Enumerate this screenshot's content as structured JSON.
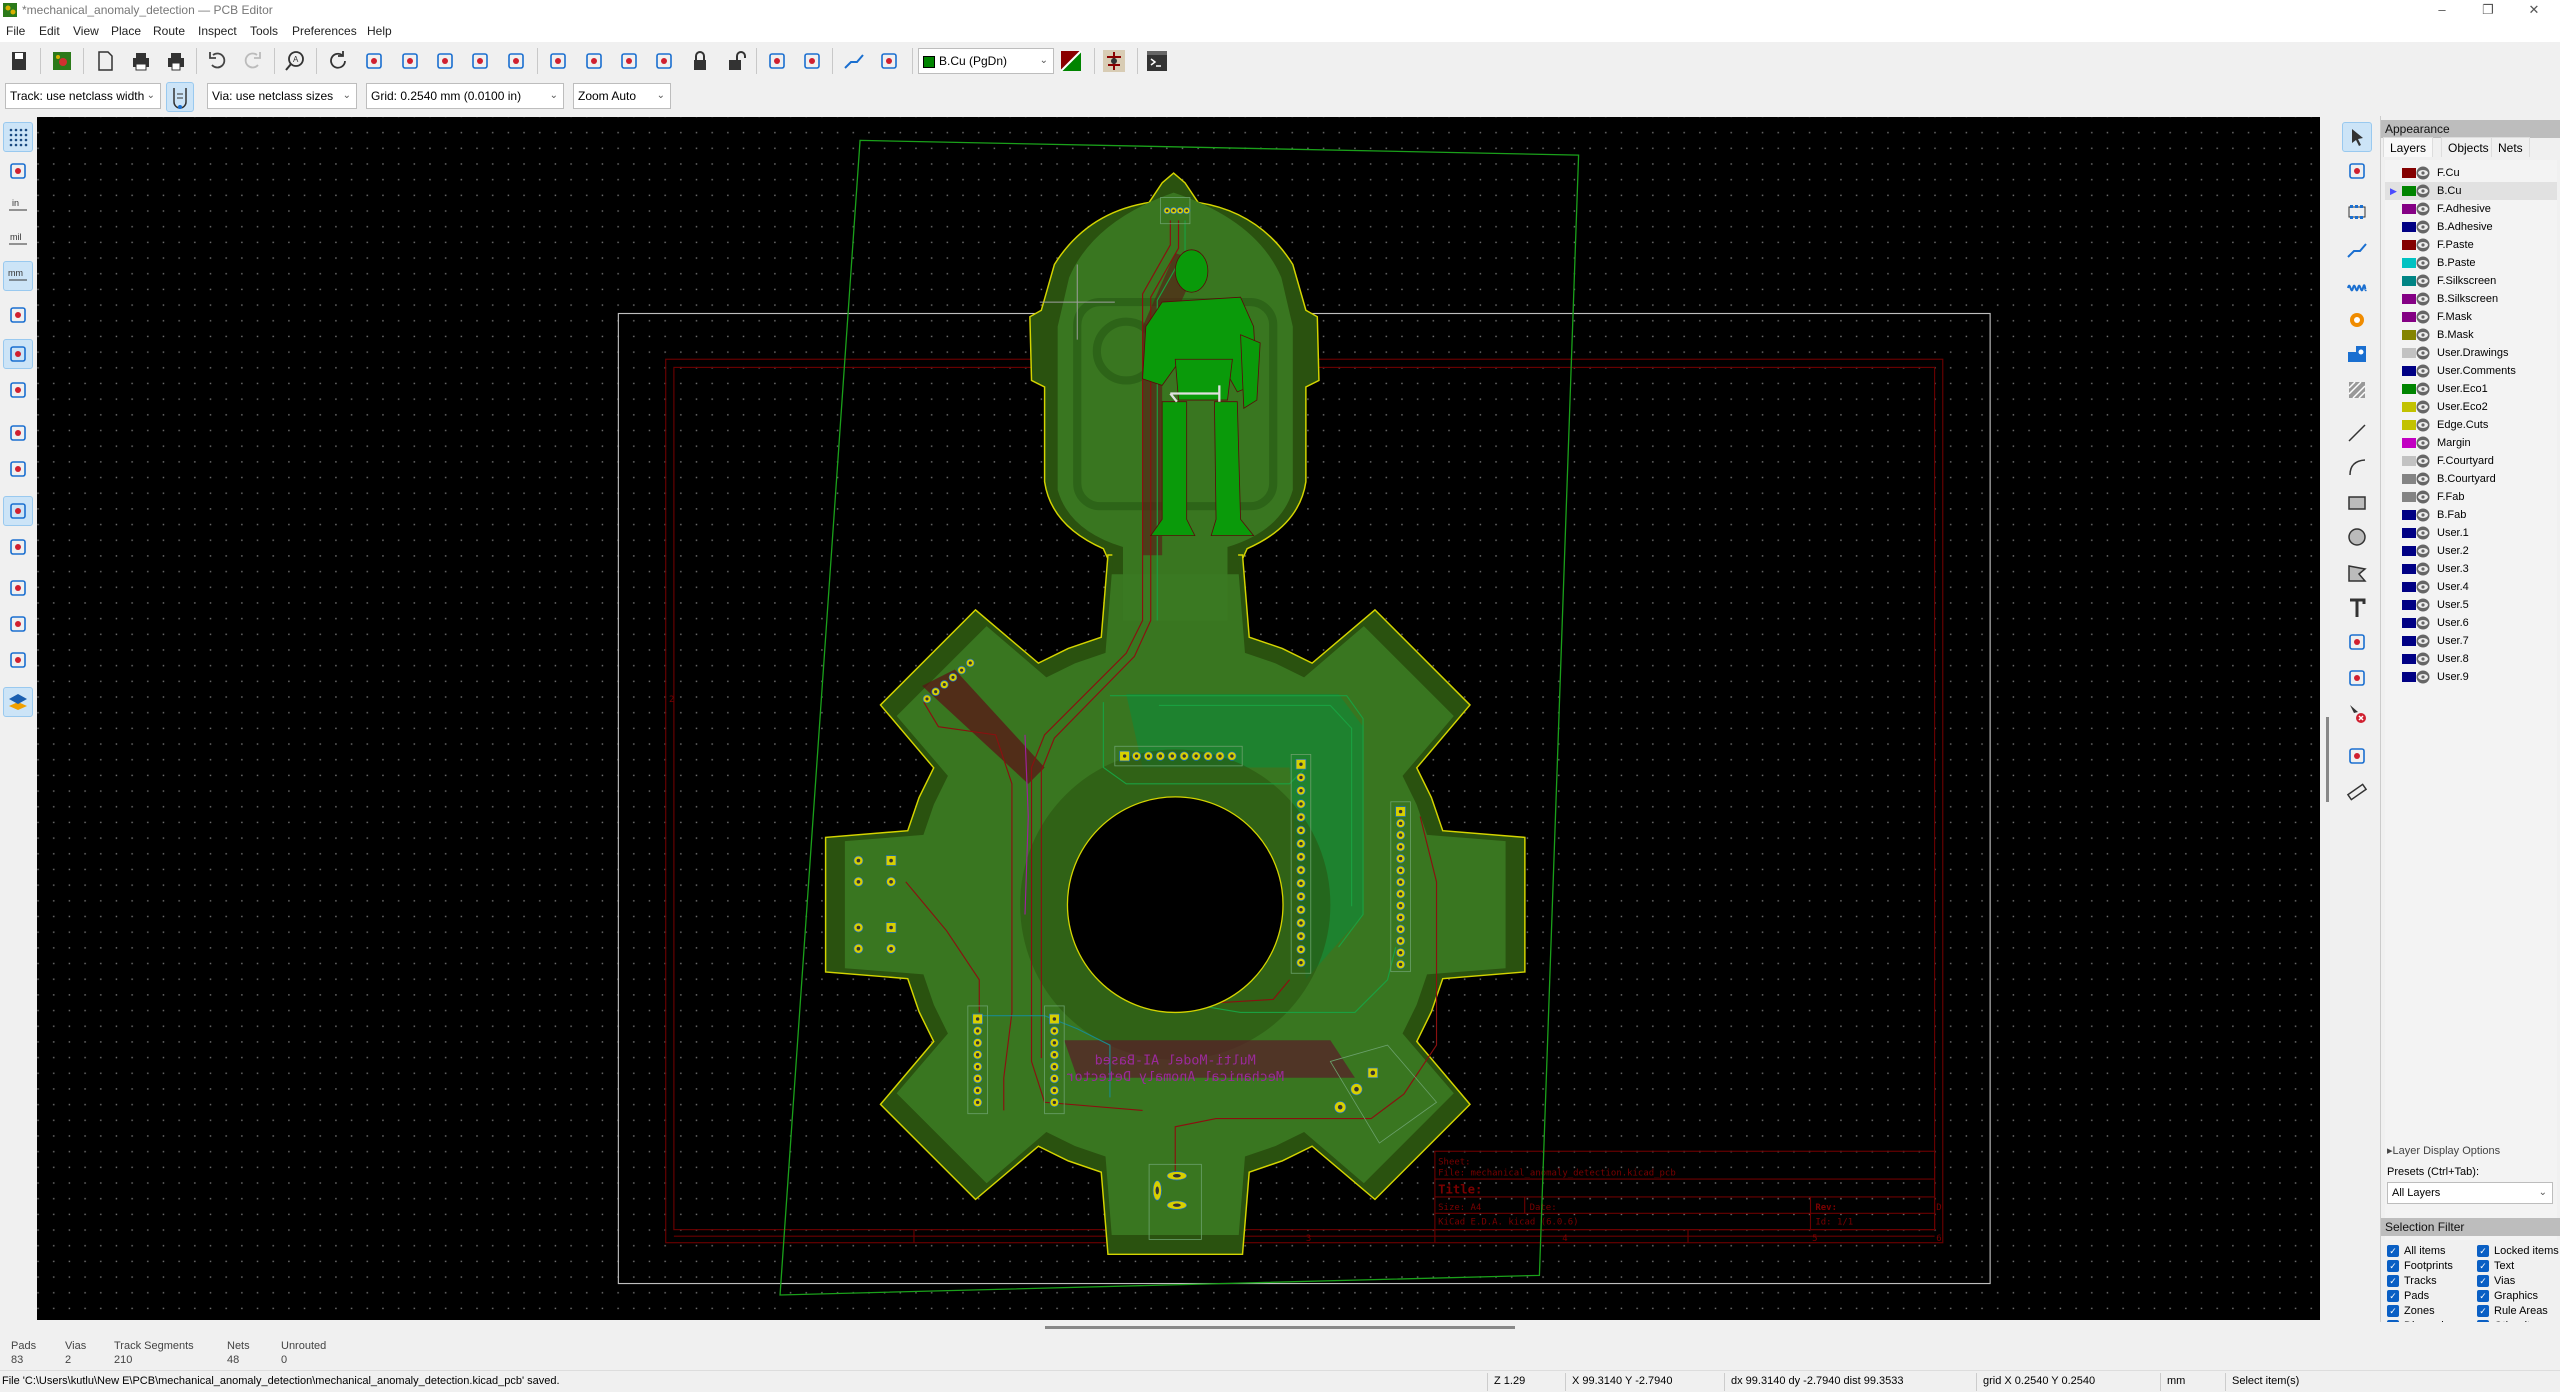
{
  "window": {
    "title": "*mechanical_anomaly_detection — PCB Editor",
    "controls": [
      "–",
      "❐",
      "✕"
    ]
  },
  "menu": [
    "File",
    "Edit",
    "View",
    "Place",
    "Route",
    "Inspect",
    "Tools",
    "Preferences",
    "Help"
  ],
  "toolbar": {
    "icons": [
      "save-icon",
      "board-setup-icon",
      "page-settings-icon",
      "print-icon",
      "plot-icon",
      "undo-icon",
      "redo-icon",
      "find-icon",
      "refresh-icon",
      "zoom-in-icon",
      "zoom-out-icon",
      "zoom-fit-icon",
      "zoom-objects-icon",
      "zoom-selection-icon",
      "rotate-ccw-icon",
      "rotate-cw-icon",
      "group-icon",
      "ungroup-icon",
      "lock-icon",
      "unlock-icon",
      "update-pcb-icon",
      "footprint-browser-icon",
      "route-track-icon",
      "drc-icon"
    ],
    "layer_select": "B.Cu (PgDn)",
    "layer_pair_icon": "layer-pair-icon",
    "extra_icons": [
      "scripting-icon",
      "terminal-icon"
    ]
  },
  "toolbar2": {
    "track": "Track: use netclass width",
    "via": "Via: use netclass sizes",
    "grid": "Grid: 0.2540 mm (0.0100 in)",
    "zoom": "Zoom Auto"
  },
  "left_toolbar": [
    "grid-dots-icon",
    "polar-coords-icon",
    "units-inch-icon",
    "units-mil-icon",
    "units-mm-icon",
    "cursor-crosshair-icon",
    "ratsnest-icon",
    "curved-ratsnest-icon",
    "high-contrast-icon",
    "track-outline-icon",
    "pad-fill-icon",
    "pad-outline-icon",
    "via-outline-icon",
    "via-fill-icon",
    "track-fill-icon",
    "layers-manager-icon"
  ],
  "left_toolbar_active": [
    0,
    4,
    6,
    10,
    15
  ],
  "right_toolbar": [
    "select-icon",
    "local-ratsnest-icon",
    "add-footprint-icon",
    "route-track-icon",
    "tune-length-icon",
    "add-via-icon",
    "add-zone-icon",
    "add-rule-area-icon",
    "draw-line-icon",
    "draw-arc-icon",
    "draw-rectangle-icon",
    "draw-circle-icon",
    "draw-polygon-icon",
    "add-text-icon",
    "add-dimension-icon",
    "add-target-icon",
    "delete-icon",
    "grid-origin-icon",
    "measure-icon"
  ],
  "appearance": {
    "title": "Appearance",
    "tabs": [
      "Layers",
      "Objects",
      "Nets"
    ],
    "active_tab": "Layers",
    "selected_layer": "B.Cu",
    "layers": [
      {
        "name": "F.Cu",
        "color": "#840000"
      },
      {
        "name": "B.Cu",
        "color": "#008400"
      },
      {
        "name": "F.Adhesive",
        "color": "#840084"
      },
      {
        "name": "B.Adhesive",
        "color": "#000084"
      },
      {
        "name": "F.Paste",
        "color": "#840000"
      },
      {
        "name": "B.Paste",
        "color": "#00c2c2"
      },
      {
        "name": "F.Silkscreen",
        "color": "#008484"
      },
      {
        "name": "B.Silkscreen",
        "color": "#840084"
      },
      {
        "name": "F.Mask",
        "color": "#840084"
      },
      {
        "name": "B.Mask",
        "color": "#848400"
      },
      {
        "name": "User.Drawings",
        "color": "#c2c2c2"
      },
      {
        "name": "User.Comments",
        "color": "#000084"
      },
      {
        "name": "User.Eco1",
        "color": "#008400"
      },
      {
        "name": "User.Eco2",
        "color": "#c2c200"
      },
      {
        "name": "Edge.Cuts",
        "color": "#c2c200"
      },
      {
        "name": "Margin",
        "color": "#c200c2"
      },
      {
        "name": "F.Courtyard",
        "color": "#c2c2c2"
      },
      {
        "name": "B.Courtyard",
        "color": "#848484"
      },
      {
        "name": "F.Fab",
        "color": "#848484"
      },
      {
        "name": "B.Fab",
        "color": "#000084"
      },
      {
        "name": "User.1",
        "color": "#000084"
      },
      {
        "name": "User.2",
        "color": "#000084"
      },
      {
        "name": "User.3",
        "color": "#000084"
      },
      {
        "name": "User.4",
        "color": "#000084"
      },
      {
        "name": "User.5",
        "color": "#000084"
      },
      {
        "name": "User.6",
        "color": "#000084"
      },
      {
        "name": "User.7",
        "color": "#000084"
      },
      {
        "name": "User.8",
        "color": "#000084"
      },
      {
        "name": "User.9",
        "color": "#000084"
      }
    ],
    "layer_display_options": "Layer Display Options",
    "presets_label": "Presets (Ctrl+Tab):",
    "presets_value": "All Layers"
  },
  "selection_filter": {
    "title": "Selection Filter",
    "items": [
      {
        "label": "All items",
        "checked": true
      },
      {
        "label": "Locked items",
        "checked": true
      },
      {
        "label": "Footprints",
        "checked": true
      },
      {
        "label": "Text",
        "checked": true
      },
      {
        "label": "Tracks",
        "checked": true
      },
      {
        "label": "Vias",
        "checked": true
      },
      {
        "label": "Pads",
        "checked": true
      },
      {
        "label": "Graphics",
        "checked": true
      },
      {
        "label": "Zones",
        "checked": true
      },
      {
        "label": "Rule Areas",
        "checked": true
      },
      {
        "label": "Dimensions",
        "checked": true
      },
      {
        "label": "Other items",
        "checked": true
      }
    ]
  },
  "board": {
    "silk_text": [
      "Multi-Model AI-Based",
      "Mechanical Anomaly Detector"
    ],
    "title_block": {
      "sheet": "Sheet:",
      "file": "File: mechanical_anomaly_detection.kicad_pcb",
      "title": "Title:",
      "size": "Size: A4",
      "date": "Date:",
      "rev": "Rev:",
      "generator": "KiCad E.D.A.  kicad (6.0.6)",
      "id": "Id: 1/1"
    },
    "frame_labels": [
      "2",
      "3",
      "4",
      "5",
      "6",
      "D"
    ],
    "colors": {
      "edge_cuts": "#c8c800",
      "copper_back": "#008400",
      "copper_front": "#840000",
      "silk_back": "#a030a0",
      "drawing_sheet": "#840000",
      "background": "#000000"
    }
  },
  "messages": {
    "labels": [
      "Pads",
      "Vias",
      "Track Segments",
      "Nets",
      "Unrouted"
    ],
    "values": [
      "83",
      "2",
      "210",
      "48",
      "0"
    ]
  },
  "status": {
    "message": "File 'C:\\Users\\kutlu\\New E\\PCB\\mechanical_anomaly_detection\\mechanical_anomaly_detection.kicad_pcb' saved.",
    "zoom": "Z 1.29",
    "cursor": "X 99.3140  Y -2.7940",
    "delta": "dx 99.3140  dy -2.7940  dist 99.3533",
    "grid": "grid X 0.2540  Y 0.2540",
    "units": "mm",
    "mode": "Select item(s)"
  }
}
